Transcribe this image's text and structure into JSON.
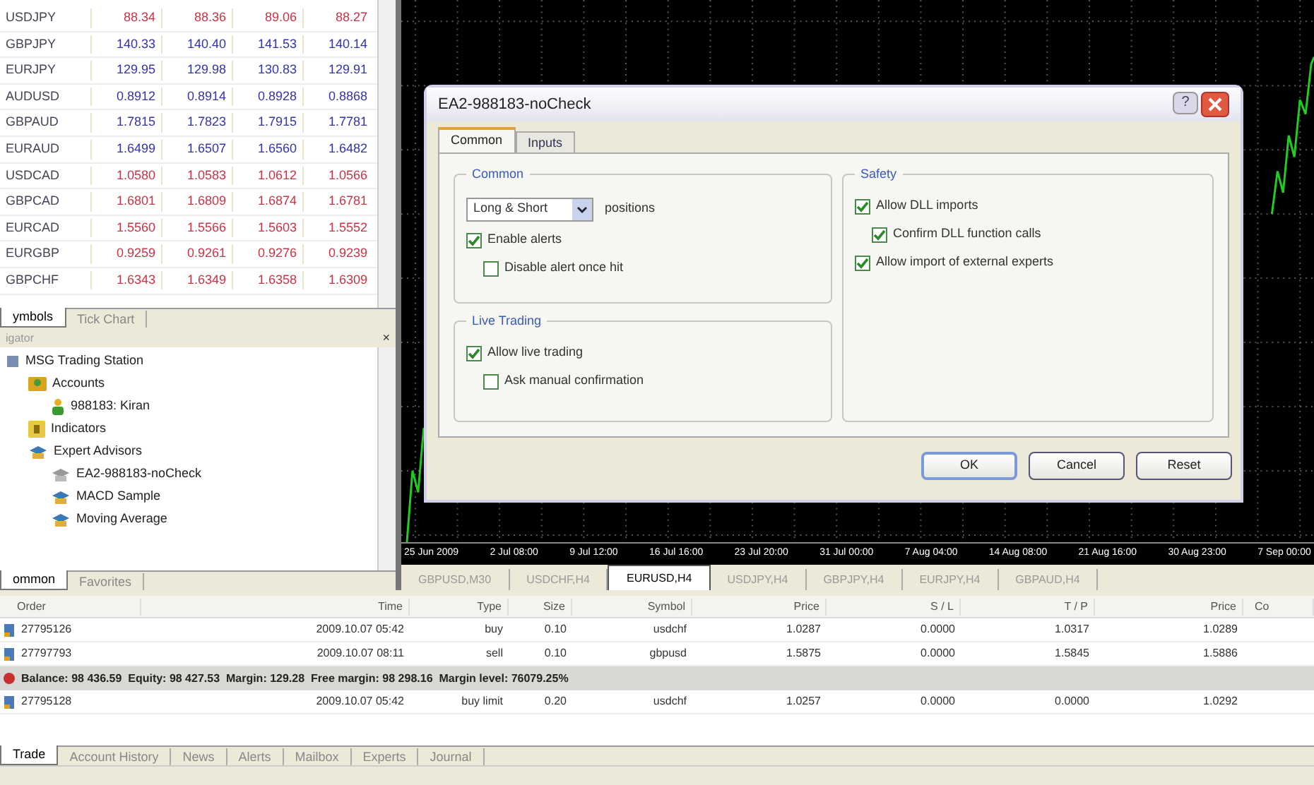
{
  "market_watch": {
    "rows": [
      {
        "symbol": "USDJPY",
        "values": [
          "88.34",
          "88.36",
          "89.06",
          "88.27"
        ],
        "color": "#cc3344"
      },
      {
        "symbol": "GBPJPY",
        "values": [
          "140.33",
          "140.40",
          "141.53",
          "140.14"
        ],
        "color": "#3333aa"
      },
      {
        "symbol": "EURJPY",
        "values": [
          "129.95",
          "129.98",
          "130.83",
          "129.91"
        ],
        "color": "#3333aa"
      },
      {
        "symbol": "AUDUSD",
        "values": [
          "0.8912",
          "0.8914",
          "0.8928",
          "0.8868"
        ],
        "color": "#3333aa"
      },
      {
        "symbol": "GBPAUD",
        "values": [
          "1.7815",
          "1.7823",
          "1.7915",
          "1.7781"
        ],
        "color": "#3333aa"
      },
      {
        "symbol": "EURAUD",
        "values": [
          "1.6499",
          "1.6507",
          "1.6560",
          "1.6482"
        ],
        "color": "#3333aa"
      },
      {
        "symbol": "USDCAD",
        "values": [
          "1.0580",
          "1.0583",
          "1.0612",
          "1.0566"
        ],
        "color": "#cc3344"
      },
      {
        "symbol": "GBPCAD",
        "values": [
          "1.6801",
          "1.6809",
          "1.6874",
          "1.6781"
        ],
        "color": "#cc3344"
      },
      {
        "symbol": "EURCAD",
        "values": [
          "1.5560",
          "1.5566",
          "1.5603",
          "1.5552"
        ],
        "color": "#cc3344"
      },
      {
        "symbol": "EURGBP",
        "values": [
          "0.9259",
          "0.9261",
          "0.9276",
          "0.9239"
        ],
        "color": "#cc3344"
      },
      {
        "symbol": "GBPCHF",
        "values": [
          "1.6343",
          "1.6349",
          "1.6358",
          "1.6309"
        ],
        "color": "#cc3344"
      }
    ],
    "tabs": [
      {
        "label": "ymbols",
        "selected": true
      },
      {
        "label": "Tick Chart",
        "selected": false
      }
    ]
  },
  "navigator": {
    "title": "igator",
    "close": "×",
    "tree": [
      {
        "label": "MSG Trading Station",
        "kind": "root",
        "children": [
          {
            "label": "Accounts",
            "kind": "accounts",
            "children": [
              {
                "label": "988183: Kiran",
                "kind": "account"
              }
            ]
          },
          {
            "label": "Indicators",
            "kind": "indicators"
          },
          {
            "label": "Expert Advisors",
            "kind": "experts",
            "children": [
              {
                "label": "EA2-988183-noCheck",
                "kind": "expert_disabled"
              },
              {
                "label": "MACD Sample",
                "kind": "expert"
              },
              {
                "label": "Moving Average",
                "kind": "expert"
              }
            ]
          }
        ]
      }
    ],
    "tabs": [
      {
        "label": "ommon",
        "selected": true
      },
      {
        "label": "Favorites",
        "selected": false
      }
    ]
  },
  "chart": {
    "date_labels": [
      "25 Jun 2009",
      "2 Jul 08:00",
      "9 Jul 12:00",
      "16 Jul 16:00",
      "23 Jul 20:00",
      "31 Jul 00:00",
      "7 Aug 04:00",
      "14 Aug 08:00",
      "21 Aug 16:00",
      "30 Aug 23:00",
      "7 Sep 00:00"
    ],
    "tabs": [
      {
        "label": "GBPUSD,M30",
        "selected": false
      },
      {
        "label": "USDCHF,H4",
        "selected": false
      },
      {
        "label": "EURUSD,H4",
        "selected": true
      },
      {
        "label": "USDJPY,H4",
        "selected": false
      },
      {
        "label": "GBPJPY,H4",
        "selected": false
      },
      {
        "label": "EURJPY,H4",
        "selected": false
      },
      {
        "label": "GBPAUD,H4",
        "selected": false
      }
    ]
  },
  "dialog": {
    "title": "EA2-988183-noCheck",
    "help": "?",
    "tabs": [
      {
        "label": "Common",
        "selected": true
      },
      {
        "label": "Inputs",
        "selected": false
      }
    ],
    "groups": [
      {
        "title": "Common",
        "dropdown": {
          "value": "Long & Short",
          "suffix": "positions"
        },
        "options": [
          {
            "label": "Enable alerts",
            "checked": true,
            "children": [
              {
                "label": "Disable alert once hit",
                "checked": false
              }
            ]
          }
        ]
      },
      {
        "title": "Live Trading",
        "options": [
          {
            "label": "Allow live trading",
            "checked": true,
            "children": [
              {
                "label": "Ask manual confirmation",
                "checked": false
              }
            ]
          }
        ]
      },
      {
        "title": "Safety",
        "options": [
          {
            "label": "Allow DLL imports",
            "checked": true,
            "children": [
              {
                "label": "Confirm DLL function calls",
                "checked": true
              }
            ]
          },
          {
            "label": "Allow import of external experts",
            "checked": true
          }
        ]
      }
    ],
    "buttons": [
      {
        "label": "OK",
        "default": true
      },
      {
        "label": "Cancel",
        "default": false
      },
      {
        "label": "Reset",
        "default": false
      }
    ]
  },
  "terminal": {
    "columns": [
      "Order",
      "Time",
      "Type",
      "Size",
      "Symbol",
      "Price",
      "S / L",
      "T / P",
      "Price",
      "Co"
    ],
    "rows": [
      {
        "kind": "order",
        "cells": [
          "27795126",
          "2009.10.07 05:42",
          "buy",
          "0.10",
          "usdchf",
          "1.0287",
          "0.0000",
          "1.0317",
          "1.0289"
        ]
      },
      {
        "kind": "order",
        "cells": [
          "27797793",
          "2009.10.07 08:11",
          "sell",
          "0.10",
          "gbpusd",
          "1.5875",
          "0.0000",
          "1.5845",
          "1.5886"
        ]
      },
      {
        "kind": "balance",
        "text": "Balance: 98 436.59  Equity: 98 427.53  Margin: 129.28  Free margin: 98 298.16  Margin level: 76079.25%"
      },
      {
        "kind": "order",
        "cells": [
          "27795128",
          "2009.10.07 05:42",
          "buy limit",
          "0.20",
          "usdchf",
          "1.0257",
          "0.0000",
          "0.0000",
          "1.0292"
        ]
      }
    ],
    "tabs": [
      {
        "label": "Trade",
        "selected": true
      },
      {
        "label": "Account History",
        "selected": false
      },
      {
        "label": "News",
        "selected": false
      },
      {
        "label": "Alerts",
        "selected": false
      },
      {
        "label": "Mailbox",
        "selected": false
      },
      {
        "label": "Experts",
        "selected": false
      },
      {
        "label": "Journal",
        "selected": false
      }
    ]
  }
}
